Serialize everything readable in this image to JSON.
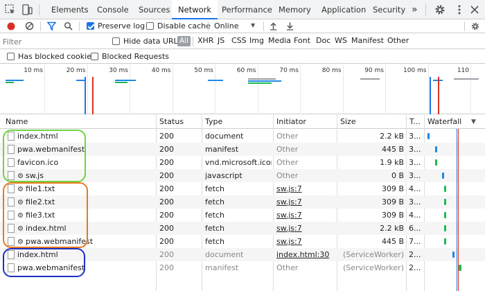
{
  "tabs": [
    "Elements",
    "Console",
    "Sources",
    "Network",
    "Performance",
    "Memory",
    "Application",
    "Security"
  ],
  "active_tab": "Network",
  "more_tabs": "»",
  "toolbar": {
    "preserve_log": "Preserve log",
    "disable_cache": "Disable cache",
    "throttle": "Online",
    "throttle_arrow": "▼"
  },
  "filter": {
    "placeholder": "Filter",
    "hide_data_urls": "Hide data URLs",
    "all": "All",
    "types": [
      "XHR",
      "JS",
      "CSS",
      "Img",
      "Media",
      "Font",
      "Doc",
      "WS",
      "Manifest",
      "Other"
    ]
  },
  "filter2": {
    "has_blocked_cookies": "Has blocked cookies",
    "blocked_requests": "Blocked Requests"
  },
  "overview": {
    "ticks": [
      "10 ms",
      "20 ms",
      "30 ms",
      "40 ms",
      "50 ms",
      "60 ms",
      "70 ms",
      "80 ms",
      "90 ms",
      "100 ms",
      "110"
    ]
  },
  "table": {
    "columns": [
      "Name",
      "Status",
      "Type",
      "Initiator",
      "Size",
      "T...",
      "Waterfall"
    ],
    "rows": [
      {
        "name": "index.html",
        "gear": false,
        "status": "200",
        "type": "document",
        "initiator": "Other",
        "initiator_link": false,
        "size": "2.2 kB",
        "time": "3...",
        "dim": false
      },
      {
        "name": "pwa.webmanifest",
        "gear": false,
        "status": "200",
        "type": "manifest",
        "initiator": "Other",
        "initiator_link": false,
        "size": "445 B",
        "time": "3...",
        "dim": false
      },
      {
        "name": "favicon.ico",
        "gear": false,
        "status": "200",
        "type": "vnd.microsoft.icon",
        "initiator": "Other",
        "initiator_link": false,
        "size": "1.9 kB",
        "time": "3...",
        "dim": false
      },
      {
        "name": "sw.js",
        "gear": true,
        "status": "200",
        "type": "javascript",
        "initiator": "Other",
        "initiator_link": false,
        "size": "0 B",
        "time": "3...",
        "dim": false
      },
      {
        "name": "file1.txt",
        "gear": true,
        "status": "200",
        "type": "fetch",
        "initiator": "sw.js:7",
        "initiator_link": true,
        "size": "309 B",
        "time": "4...",
        "dim": false
      },
      {
        "name": "file2.txt",
        "gear": true,
        "status": "200",
        "type": "fetch",
        "initiator": "sw.js:7",
        "initiator_link": true,
        "size": "309 B",
        "time": "3...",
        "dim": false
      },
      {
        "name": "file3.txt",
        "gear": true,
        "status": "200",
        "type": "fetch",
        "initiator": "sw.js:7",
        "initiator_link": true,
        "size": "309 B",
        "time": "4...",
        "dim": false
      },
      {
        "name": "index.html",
        "gear": true,
        "status": "200",
        "type": "fetch",
        "initiator": "sw.js:7",
        "initiator_link": true,
        "size": "2.2 kB",
        "time": "6...",
        "dim": false
      },
      {
        "name": "pwa.webmanifest",
        "gear": true,
        "status": "200",
        "type": "fetch",
        "initiator": "sw.js:7",
        "initiator_link": true,
        "size": "445 B",
        "time": "7...",
        "dim": false
      },
      {
        "name": "index.html",
        "gear": false,
        "status": "200",
        "type": "document",
        "initiator": "index.html:30",
        "initiator_link": true,
        "size": "(ServiceWorker)",
        "time": "2...",
        "dim": true
      },
      {
        "name": "pwa.webmanifest",
        "gear": false,
        "status": "200",
        "type": "manifest",
        "initiator": "Other",
        "initiator_link": false,
        "size": "(ServiceWorker)",
        "time": "2...",
        "dim": true
      }
    ]
  },
  "colors": {
    "accent": "#1a73e8",
    "highlight_green": "#6fd53f",
    "highlight_orange": "#e8781e",
    "highlight_blue": "#1d2fc4",
    "record_red": "#d93025",
    "waterfall_blue": "#1e88e5",
    "waterfall_green": "#1db954"
  }
}
